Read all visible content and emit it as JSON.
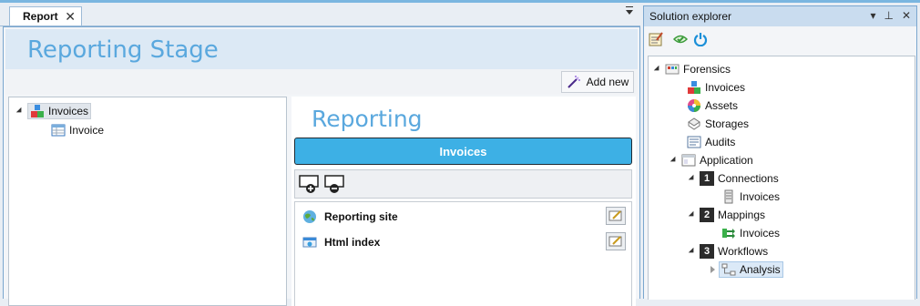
{
  "document_tab": {
    "title": "Report"
  },
  "stage": {
    "title": "Reporting Stage",
    "add_new_label": "Add new"
  },
  "left_tree": {
    "root": {
      "label": "Invoices"
    },
    "child": {
      "label": "Invoice"
    }
  },
  "main": {
    "title": "Reporting",
    "bar_label": "Invoices",
    "items": [
      {
        "label": "Reporting site"
      },
      {
        "label": "Html index"
      }
    ]
  },
  "solution_explorer": {
    "title": "Solution explorer",
    "tree": {
      "root": "Forensics",
      "invoices": "Invoices",
      "assets": "Assets",
      "storages": "Storages",
      "audits": "Audits",
      "application": "Application",
      "connections_num": "1",
      "connections": "Connections",
      "connections_invoices": "Invoices",
      "mappings_num": "2",
      "mappings": "Mappings",
      "mappings_invoices": "Invoices",
      "workflows_num": "3",
      "workflows": "Workflows",
      "analysis": "Analysis"
    }
  },
  "colors": {
    "accent": "#3db0e5",
    "title_blue": "#5aa8de",
    "header_bg": "#dce9f5"
  }
}
